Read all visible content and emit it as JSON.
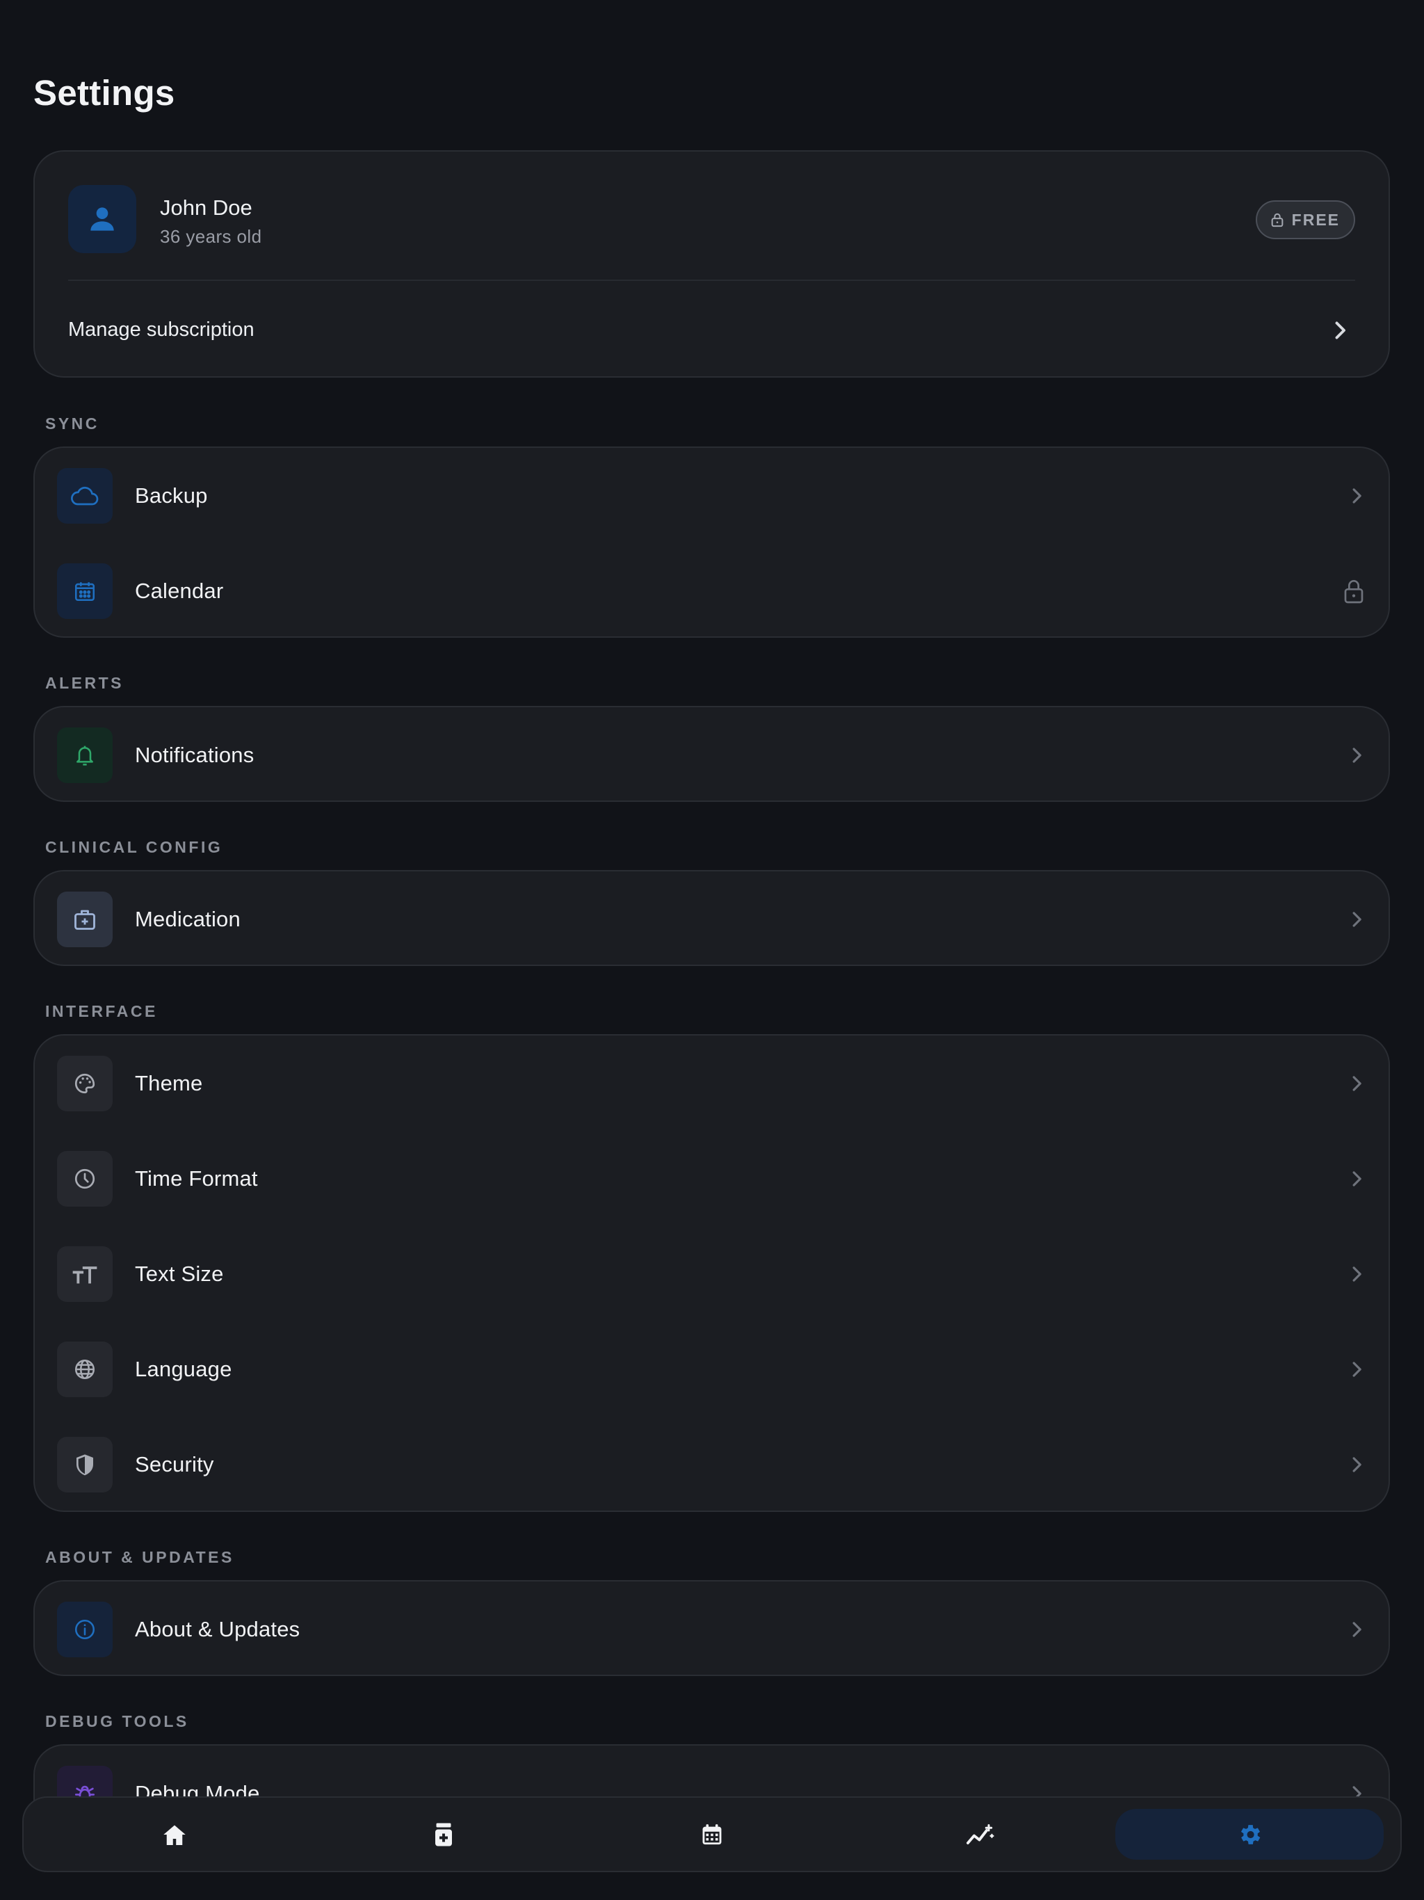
{
  "header": {
    "title": "Settings"
  },
  "profile": {
    "name": "John Doe",
    "age": "36 years old",
    "badge": "FREE",
    "manage_subscription": "Manage subscription"
  },
  "sections": {
    "sync": {
      "label": "SYNC",
      "items": [
        {
          "label": "Backup",
          "icon": "cloud-icon",
          "trailing": "chevron"
        },
        {
          "label": "Calendar",
          "icon": "calendar-icon",
          "trailing": "lock"
        }
      ]
    },
    "alerts": {
      "label": "ALERTS",
      "items": [
        {
          "label": "Notifications",
          "icon": "bell-icon",
          "trailing": "chevron"
        }
      ]
    },
    "clinical": {
      "label": "CLINICAL CONFIG",
      "items": [
        {
          "label": "Medication",
          "icon": "medical-kit-icon",
          "trailing": "chevron"
        }
      ]
    },
    "interface": {
      "label": "INTERFACE",
      "items": [
        {
          "label": "Theme",
          "icon": "palette-icon",
          "trailing": "chevron"
        },
        {
          "label": "Time Format",
          "icon": "clock-icon",
          "trailing": "chevron"
        },
        {
          "label": "Text Size",
          "icon": "text-size-icon",
          "trailing": "chevron"
        },
        {
          "label": "Language",
          "icon": "globe-icon",
          "trailing": "chevron"
        },
        {
          "label": "Security",
          "icon": "shield-icon",
          "trailing": "chevron"
        }
      ]
    },
    "about": {
      "label": "ABOUT & UPDATES",
      "items": [
        {
          "label": "About & Updates",
          "icon": "info-icon",
          "trailing": "chevron"
        }
      ]
    },
    "debug": {
      "label": "DEBUG TOOLS",
      "items": [
        {
          "label": "Debug Mode",
          "icon": "bug-icon",
          "trailing": "chevron"
        }
      ]
    }
  },
  "bottom_nav": {
    "items": [
      {
        "icon": "home-icon",
        "active": false
      },
      {
        "icon": "medication-bottle-icon",
        "active": false
      },
      {
        "icon": "calendar-icon",
        "active": false
      },
      {
        "icon": "trend-chart-icon",
        "active": false
      },
      {
        "icon": "gear-icon",
        "active": true
      }
    ]
  },
  "colors": {
    "background": "#111318",
    "card": "#1b1d22",
    "accent_blue": "#1f6fc0",
    "accent_green": "#2fa86a",
    "accent_purple": "#7a4fd8",
    "text_primary": "#f1f2f4",
    "text_muted": "#8b8f98"
  }
}
